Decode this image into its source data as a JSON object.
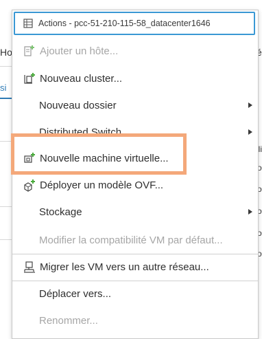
{
  "background": {
    "left_fragment_1": "Ho",
    "left_fragment_2": "si",
    "right_fragment_1": "ée",
    "right_fragment_2": "ili",
    "right_fragment_3": "o",
    "right_fragment_4": "o",
    "right_fragment_5": "o",
    "right_fragment_6": "o",
    "right_fragment_7": "o"
  },
  "menu": {
    "header": {
      "label": "Actions - pcc-51-210-115-58_datacenter1646",
      "icon": "datacenter-icon"
    },
    "items": [
      {
        "label": "Ajouter un hôte...",
        "icon": "add-host-icon",
        "disabled": true,
        "submenu": false
      },
      {
        "label": "Nouveau cluster...",
        "icon": "new-cluster-icon",
        "disabled": false,
        "submenu": false
      },
      {
        "label": "Nouveau dossier",
        "icon": "",
        "disabled": false,
        "submenu": true
      },
      {
        "label": "Distributed Switch",
        "icon": "",
        "disabled": false,
        "submenu": true
      },
      {
        "label": "Nouvelle machine virtuelle...",
        "icon": "new-vm-icon",
        "disabled": false,
        "submenu": false
      },
      {
        "label": "Déployer un modèle OVF...",
        "icon": "deploy-ovf-icon",
        "disabled": false,
        "submenu": false
      },
      {
        "label": "Stockage",
        "icon": "",
        "disabled": false,
        "submenu": true
      },
      {
        "label": "Modifier la compatibilité VM par défaut...",
        "icon": "",
        "disabled": true,
        "submenu": false
      },
      {
        "label": "Migrer les VM vers un autre réseau...",
        "icon": "migrate-network-icon",
        "disabled": false,
        "submenu": false
      },
      {
        "label": "Déplacer vers...",
        "icon": "",
        "disabled": false,
        "submenu": false
      },
      {
        "label": "Renommer...",
        "icon": "",
        "disabled": true,
        "submenu": false
      }
    ]
  },
  "colors": {
    "accent_border": "#3a98d4",
    "highlight_annotation": "#f4a87a",
    "icon_green": "#4aaa3c",
    "disabled_text": "#a6a6a6"
  }
}
